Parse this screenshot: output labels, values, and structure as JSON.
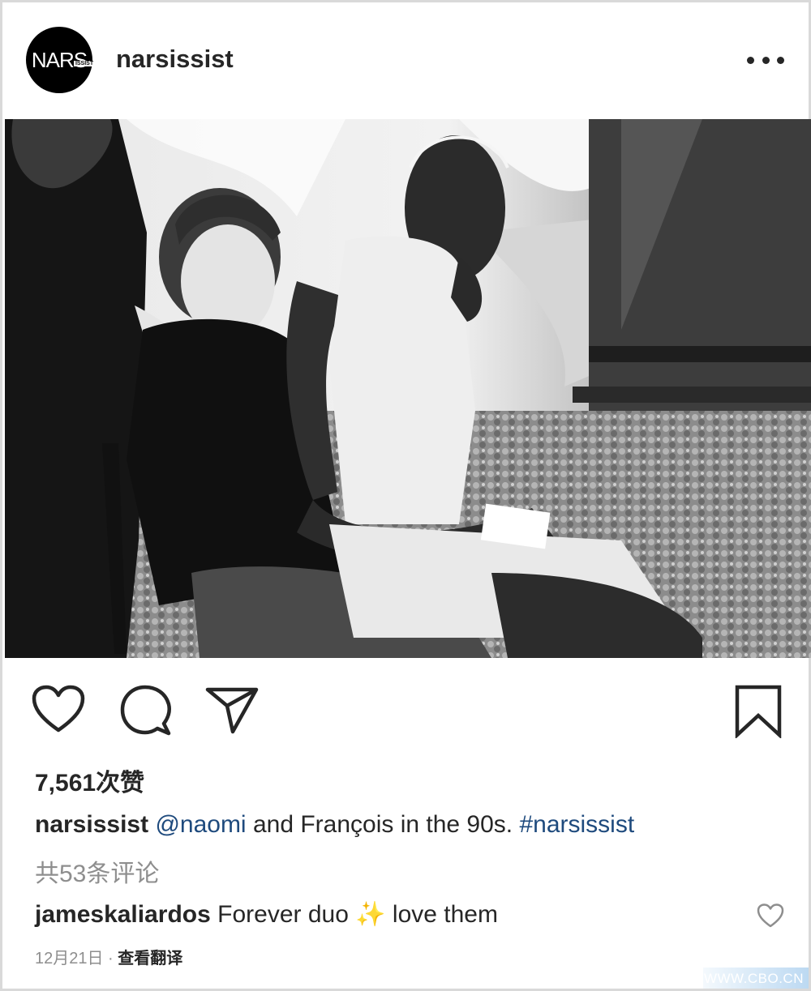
{
  "header": {
    "avatar_logo": "NARS",
    "avatar_logo_sub": "ISSIST",
    "username": "narsissist",
    "more_icon": "more-horizontal-icon"
  },
  "photo": {
    "icon": "photo"
  },
  "actions": {
    "like_icon": "heart-outline-icon",
    "comment_icon": "comment-bubble-icon",
    "share_icon": "paper-plane-icon",
    "save_icon": "bookmark-outline-icon"
  },
  "likes": "7,561次赞",
  "caption": {
    "user": "narsissist",
    "mention": "@naomi",
    "text": " and François in the 90s. ",
    "hashtag": "#narsissist"
  },
  "comments_count": "共53条评论",
  "comment": {
    "user": "jameskaliardos",
    "text_before": " Forever duo ",
    "emoji": "✨",
    "text_after": " love them"
  },
  "meta": {
    "date": "12月21日",
    "separator": " · ",
    "translate": "查看翻译"
  },
  "watermark": "WWW.CBO.CN",
  "colors": {
    "text": "#262626",
    "link": "#1e4a7d",
    "muted": "#8e8e8e"
  }
}
